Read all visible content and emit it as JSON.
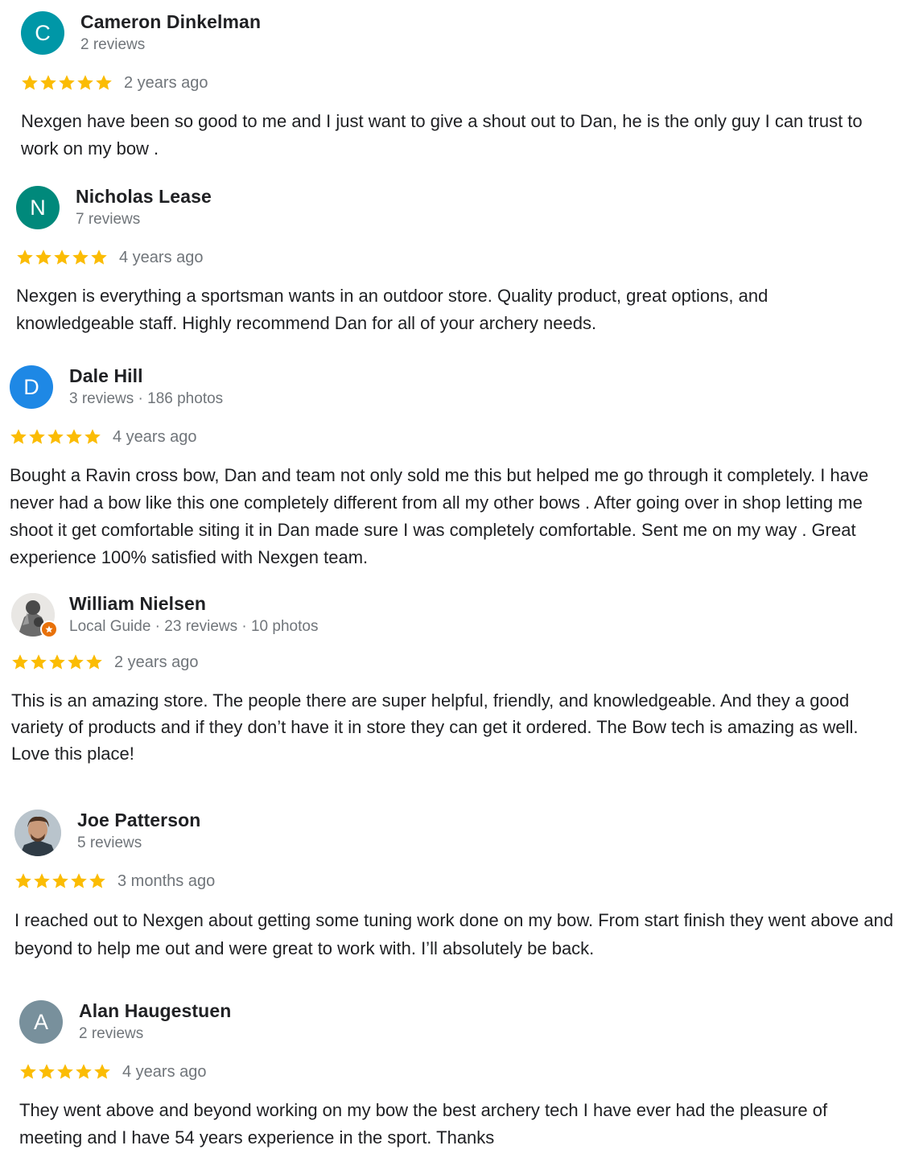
{
  "colors": {
    "star": "#fbbc04",
    "meta": "#70757a",
    "text": "#202124",
    "guide_badge": "#e8710a"
  },
  "reviews": [
    {
      "name": "Cameron Dinkelman",
      "meta": "2 reviews",
      "avatar_letter": "C",
      "avatar_color": "#0097a7",
      "rating": 5,
      "time": "2 years ago",
      "text": "Nexgen have been so good to me and I just want to give a shout out to Dan, he is the only guy I can trust to work on my bow ."
    },
    {
      "name": "Nicholas Lease",
      "meta": "7 reviews",
      "avatar_letter": "N",
      "avatar_color": "#00897b",
      "rating": 5,
      "time": "4 years ago",
      "text": "Nexgen is everything a sportsman wants in an outdoor store. Quality product, great options, and knowledgeable staff. Highly recommend Dan for all of your archery needs."
    },
    {
      "name": "Dale Hill",
      "meta": "3 reviews · 186 photos",
      "avatar_letter": "D",
      "avatar_color": "#1e88e5",
      "rating": 5,
      "time": "4 years ago",
      "text": "Bought a Ravin cross bow, Dan and team not only sold me this but helped me go through it completely. I have never had a bow like this one completely different from all my other bows . After going over in shop letting me shoot it get comfortable siting it in Dan made sure I was completely comfortable. Sent me on my way . Great experience 100% satisfied with Nexgen team."
    },
    {
      "name": "William Nielsen",
      "meta": "Local Guide · 23 reviews · 10 photos",
      "avatar_icon": "user-photo-icon",
      "rating": 5,
      "time": "2 years ago",
      "text": "This is an amazing store. The people there are super helpful, friendly, and knowledgeable. And they a good variety of products and if they don’t have it in store they can get it ordered. The Bow tech is amazing as well. Love this place!"
    },
    {
      "name": "Joe Patterson",
      "meta": "5 reviews",
      "avatar_icon": "user-photo-icon",
      "rating": 5,
      "time": "3 months ago",
      "text": "I reached out to Nexgen about getting some tuning work done on my bow. From start finish they went above and beyond to help me out and were great to work with. I’ll absolutely be back."
    },
    {
      "name": "Alan Haugestuen",
      "meta": "2 reviews",
      "avatar_letter": "A",
      "avatar_color": "#78909c",
      "rating": 5,
      "time": "4 years ago",
      "text": "They went above and beyond working on my bow the best archery tech I have ever had the pleasure of meeting and I have 54 years experience in the sport. Thanks"
    }
  ]
}
